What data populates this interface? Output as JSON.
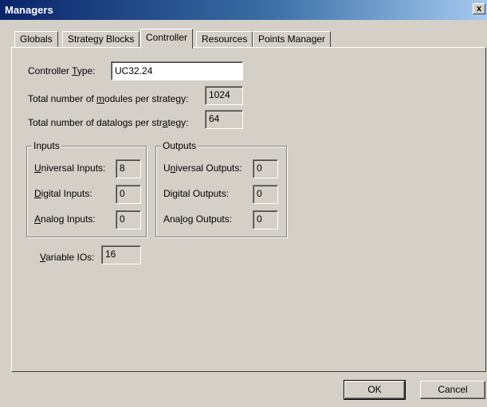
{
  "window": {
    "title": "Managers",
    "close_glyph": "x"
  },
  "tabs": [
    {
      "label": "Globals",
      "active": false
    },
    {
      "label": "Strategy Blocks",
      "active": false
    },
    {
      "label": "Controller",
      "active": true
    },
    {
      "label": "Resources",
      "active": false
    },
    {
      "label": "Points Manager",
      "active": false
    }
  ],
  "controller": {
    "type_label": {
      "pre": "Controller ",
      "ul": "T",
      "post": "ype:"
    },
    "type_value": "UC32.24",
    "modules_label": {
      "pre": "Total number of ",
      "ul": "m",
      "post": "odules per strategy:"
    },
    "modules_value": "1024",
    "datalogs_label": {
      "pre": "Total number of datalogs per str",
      "ul": "a",
      "post": "tegy:"
    },
    "datalogs_value": "64"
  },
  "inputs": {
    "title": "Inputs",
    "universal": {
      "ul": "U",
      "post": "niversal Inputs:",
      "value": "8"
    },
    "digital": {
      "ul": "D",
      "post": "igital Inputs:",
      "value": "0"
    },
    "analog": {
      "ul": "A",
      "post": "nalog Inputs:",
      "value": "0"
    }
  },
  "outputs": {
    "title": "Outputs",
    "universal": {
      "pre": "U",
      "ul": "n",
      "post": "iversal Outputs:",
      "value": "0"
    },
    "digital": {
      "pre": "Di",
      "ul": "g",
      "post": "ital Outputs:",
      "value": "0"
    },
    "analog": {
      "pre": "Ana",
      "ul": "l",
      "post": "og Outputs:",
      "value": "0"
    }
  },
  "variable_ios": {
    "ul": "V",
    "post": "ariable IOs:",
    "value": "16"
  },
  "buttons": {
    "ok": "OK",
    "cancel": "Cancel"
  }
}
